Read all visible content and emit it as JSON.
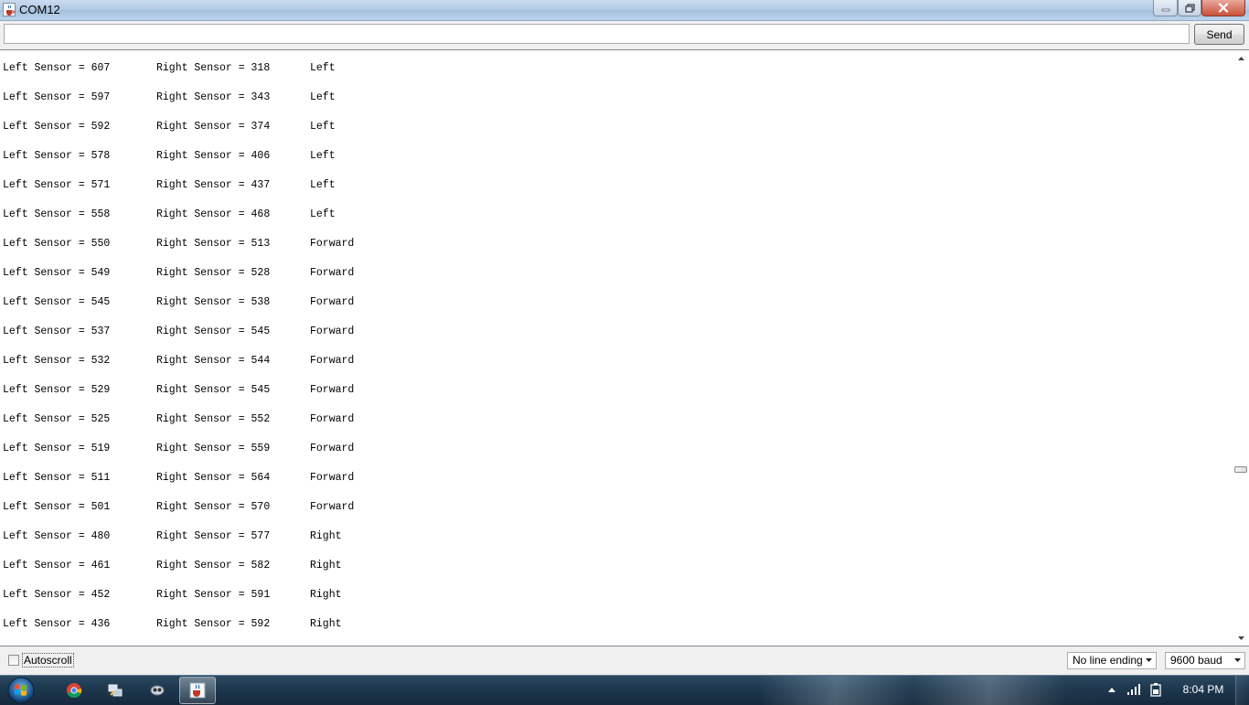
{
  "window": {
    "title": "COM12"
  },
  "send_row": {
    "input_value": "",
    "send_label": "Send"
  },
  "serial_output": {
    "lines": [
      {
        "left": "Left Sensor = 607",
        "right": "Right Sensor = 318",
        "direction": "Left"
      },
      {
        "left": "Left Sensor = 597",
        "right": "Right Sensor = 343",
        "direction": "Left"
      },
      {
        "left": "Left Sensor = 592",
        "right": "Right Sensor = 374",
        "direction": "Left"
      },
      {
        "left": "Left Sensor = 578",
        "right": "Right Sensor = 406",
        "direction": "Left"
      },
      {
        "left": "Left Sensor = 571",
        "right": "Right Sensor = 437",
        "direction": "Left"
      },
      {
        "left": "Left Sensor = 558",
        "right": "Right Sensor = 468",
        "direction": "Left"
      },
      {
        "left": "Left Sensor = 550",
        "right": "Right Sensor = 513",
        "direction": "Forward"
      },
      {
        "left": "Left Sensor = 549",
        "right": "Right Sensor = 528",
        "direction": "Forward"
      },
      {
        "left": "Left Sensor = 545",
        "right": "Right Sensor = 538",
        "direction": "Forward"
      },
      {
        "left": "Left Sensor = 537",
        "right": "Right Sensor = 545",
        "direction": "Forward"
      },
      {
        "left": "Left Sensor = 532",
        "right": "Right Sensor = 544",
        "direction": "Forward"
      },
      {
        "left": "Left Sensor = 529",
        "right": "Right Sensor = 545",
        "direction": "Forward"
      },
      {
        "left": "Left Sensor = 525",
        "right": "Right Sensor = 552",
        "direction": "Forward"
      },
      {
        "left": "Left Sensor = 519",
        "right": "Right Sensor = 559",
        "direction": "Forward"
      },
      {
        "left": "Left Sensor = 511",
        "right": "Right Sensor = 564",
        "direction": "Forward"
      },
      {
        "left": "Left Sensor = 501",
        "right": "Right Sensor = 570",
        "direction": "Forward"
      },
      {
        "left": "Left Sensor = 480",
        "right": "Right Sensor = 577",
        "direction": "Right"
      },
      {
        "left": "Left Sensor = 461",
        "right": "Right Sensor = 582",
        "direction": "Right"
      },
      {
        "left": "Left Sensor = 452",
        "right": "Right Sensor = 591",
        "direction": "Right"
      },
      {
        "left": "Left Sensor = 436",
        "right": "Right Sensor = 592",
        "direction": "Right"
      }
    ]
  },
  "status_row": {
    "autoscroll_label": "Autoscroll",
    "autoscroll_checked": false,
    "line_ending_selected": "No line ending",
    "baud_selected": "9600 baud"
  },
  "taskbar": {
    "apps": [
      {
        "icon": "chrome-icon"
      },
      {
        "icon": "network-tool-icon"
      },
      {
        "icon": "eye-app-icon"
      },
      {
        "icon": "java-icon",
        "active": true
      }
    ],
    "clock": "8:04 PM"
  }
}
